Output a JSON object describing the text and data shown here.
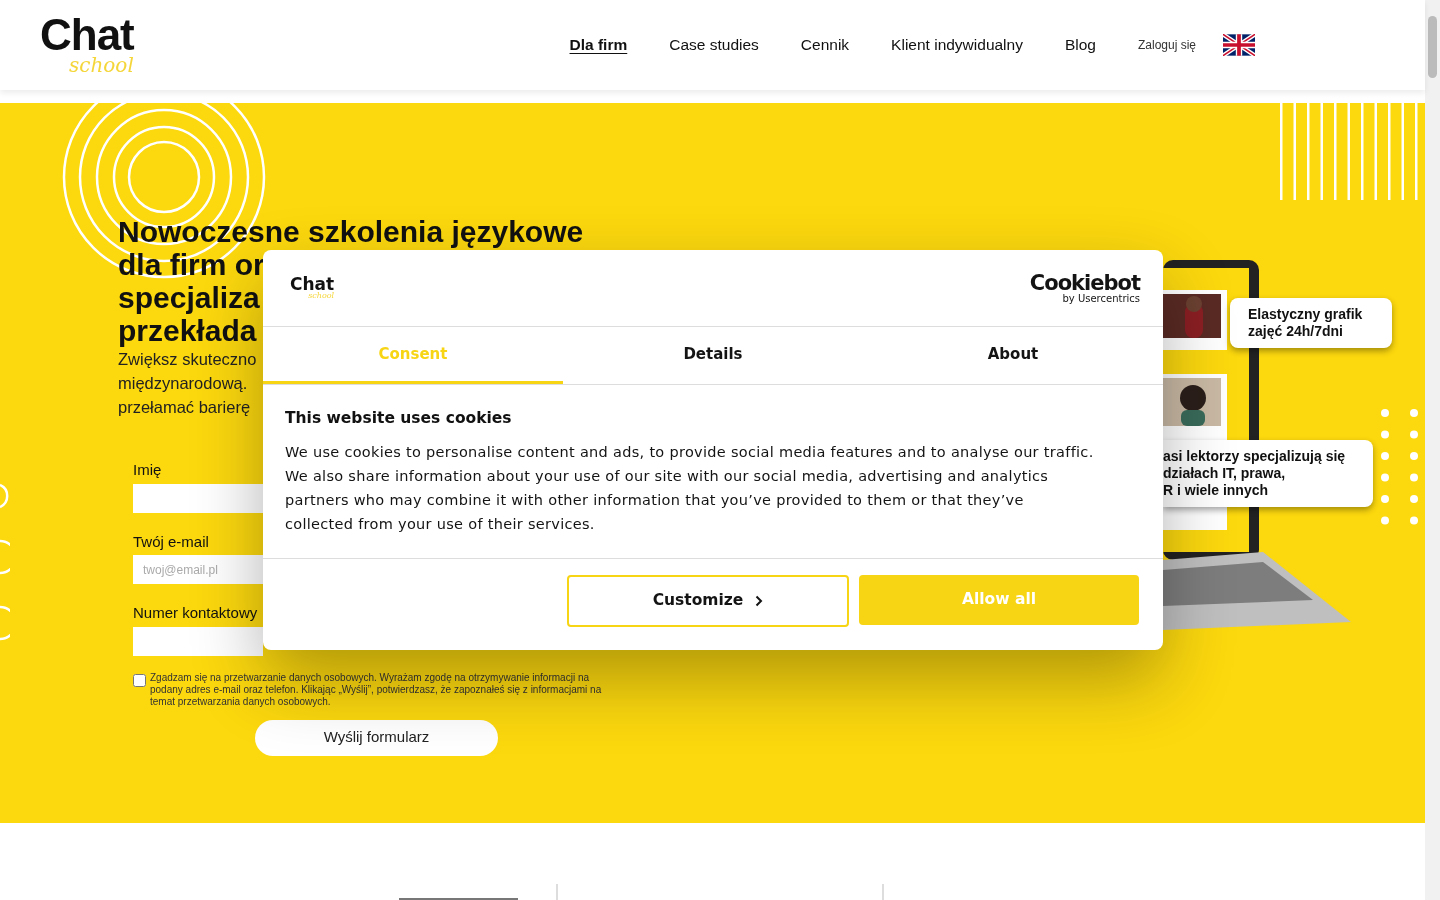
{
  "header": {
    "logo": {
      "word": "Chat",
      "script": "school"
    },
    "nav": [
      {
        "label": "Dla firm",
        "selected": true
      },
      {
        "label": "Case studies",
        "selected": false
      },
      {
        "label": "Cennik",
        "selected": false
      },
      {
        "label": "Klient indywidualny",
        "selected": false
      },
      {
        "label": "Blog",
        "selected": false
      }
    ],
    "login": "Zaloguj się"
  },
  "hero": {
    "heading_lines": [
      "Nowoczesne szkolenia językowe",
      "dla firm or",
      "specjaliza",
      "przekłada"
    ],
    "lead_lines": [
      "Zwiększ skuteczno",
      "międzynarodową.",
      "przełamać barierę"
    ],
    "form": {
      "fields": [
        {
          "label": "Imię"
        },
        {
          "label": "Twój e-mail",
          "placeholder": "twoj@email.pl"
        },
        {
          "label": "Numer kontaktowy"
        }
      ],
      "consent": {
        "checked": false,
        "text": "Zgadzam się na przetwarzanie danych osobowych. Wyrażam zgodę na otrzymywanie informacji na podany adres e-mail oraz telefon. Klikając „Wyślij”, potwierdzasz, że zapoznałeś się z informacjami na temat przetwarzania danych osobowych."
      },
      "submit": "Wyślij formularz"
    },
    "bubbles": [
      {
        "lines": [
          "Elastyczny grafik",
          "zajęć 24h/7dni"
        ]
      },
      {
        "lines": [
          "asi lektorzy specjalizują się",
          "działach IT, prawa,",
          "R i wiele innych"
        ]
      }
    ]
  },
  "cookie_banner": {
    "logo": {
      "word": "Chat",
      "script": "school"
    },
    "brand": "Cookiebot",
    "brand_sub": "by Usercentrics",
    "tabs": [
      {
        "label": "Consent",
        "selected": true
      },
      {
        "label": "Details",
        "selected": false
      },
      {
        "label": "About",
        "selected": false
      }
    ],
    "title": "This website uses cookies",
    "text": "We use cookies to personalise content and ads, to provide social media features and to analyse our traffic. We also share information about your use of our site with our social media, advertising and analytics partners who may combine it with other information that you’ve provided to them or that they’ve collected from your use of their services.",
    "buttons": [
      {
        "label": "Customize",
        "kind": "outline"
      },
      {
        "label": "Allow all",
        "kind": "primary"
      }
    ]
  }
}
